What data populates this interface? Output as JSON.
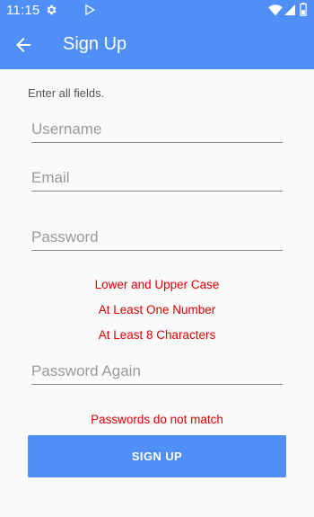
{
  "status": {
    "time": "11:15"
  },
  "header": {
    "title": "Sign Up"
  },
  "form": {
    "hint": "Enter all fields.",
    "username_placeholder": "Username",
    "email_placeholder": "Email",
    "password_placeholder": "Password",
    "password_rules": [
      "Lower and Upper Case",
      "At Least One Number",
      "At Least 8 Characters"
    ],
    "password_again_placeholder": "Password Again",
    "mismatch_error": "Passwords do not match",
    "submit_label": "SIGN UP"
  },
  "colors": {
    "primary": "#4f8ff7",
    "error": "#e00000"
  },
  "icons": [
    "settings-icon",
    "play-store-icon",
    "wifi-icon",
    "cell-signal-icon",
    "battery-icon",
    "back-arrow-icon"
  ]
}
